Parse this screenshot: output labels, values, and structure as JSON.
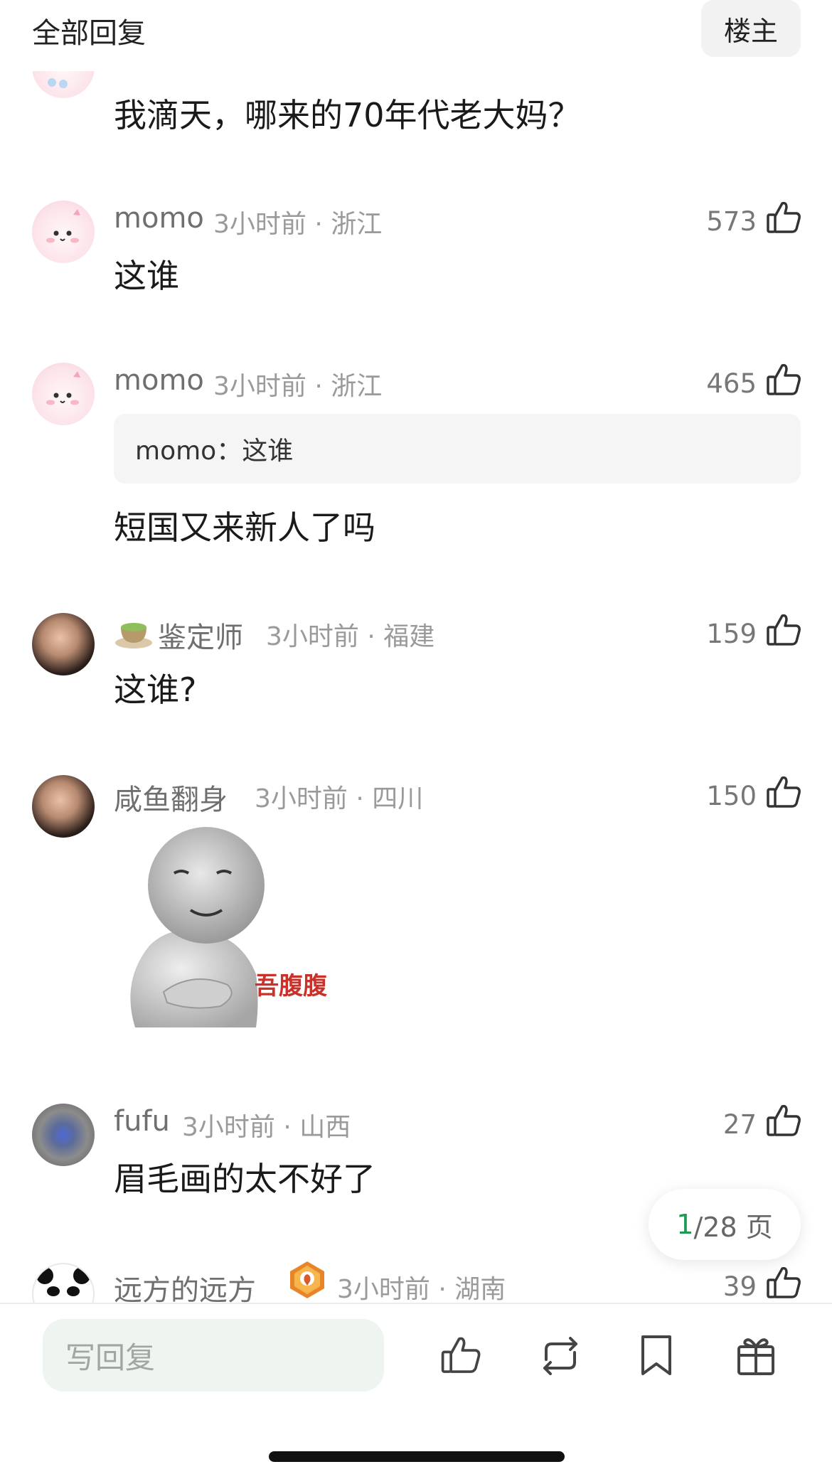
{
  "header": {
    "title": "全部回复",
    "op_button": "楼主"
  },
  "top_comment": {
    "text": "我滴天，哪来的70年代老大妈？"
  },
  "comments": [
    {
      "name": "momo",
      "meta": "3小时前 · 浙江",
      "likes": "573",
      "text": "这谁"
    },
    {
      "name": "momo",
      "meta": "3小时前 · 浙江",
      "likes": "465",
      "quote": "momo：这谁",
      "text": "短国又来新人了吗"
    },
    {
      "name": "鉴定师",
      "meta": "3小时前 · 福建",
      "likes": "159",
      "text": "这谁?",
      "name_icon": "tea-cup-icon"
    },
    {
      "name": "咸鱼翻身",
      "meta": "3小时前 · 四川",
      "likes": "150",
      "sticker_text": "吾腹腹"
    },
    {
      "name": "fufu",
      "meta": "3小时前 · 山西",
      "likes": "27",
      "text": "眉毛画的太不好了"
    },
    {
      "name": "远方的远方",
      "meta": "3小时前 · 湖南",
      "likes": "39",
      "badge_icon": "eagle-badge-icon"
    }
  ],
  "pager": {
    "current": "1",
    "total": "/28 页"
  },
  "bottom_bar": {
    "reply_placeholder": "写回复",
    "icons": [
      "thumb-up-icon",
      "repost-icon",
      "bookmark-icon",
      "gift-icon"
    ]
  },
  "colors": {
    "accent_green": "#1d9a52",
    "reply_box_bg": "#eef4f0",
    "quote_bg": "#f5f5f5"
  }
}
